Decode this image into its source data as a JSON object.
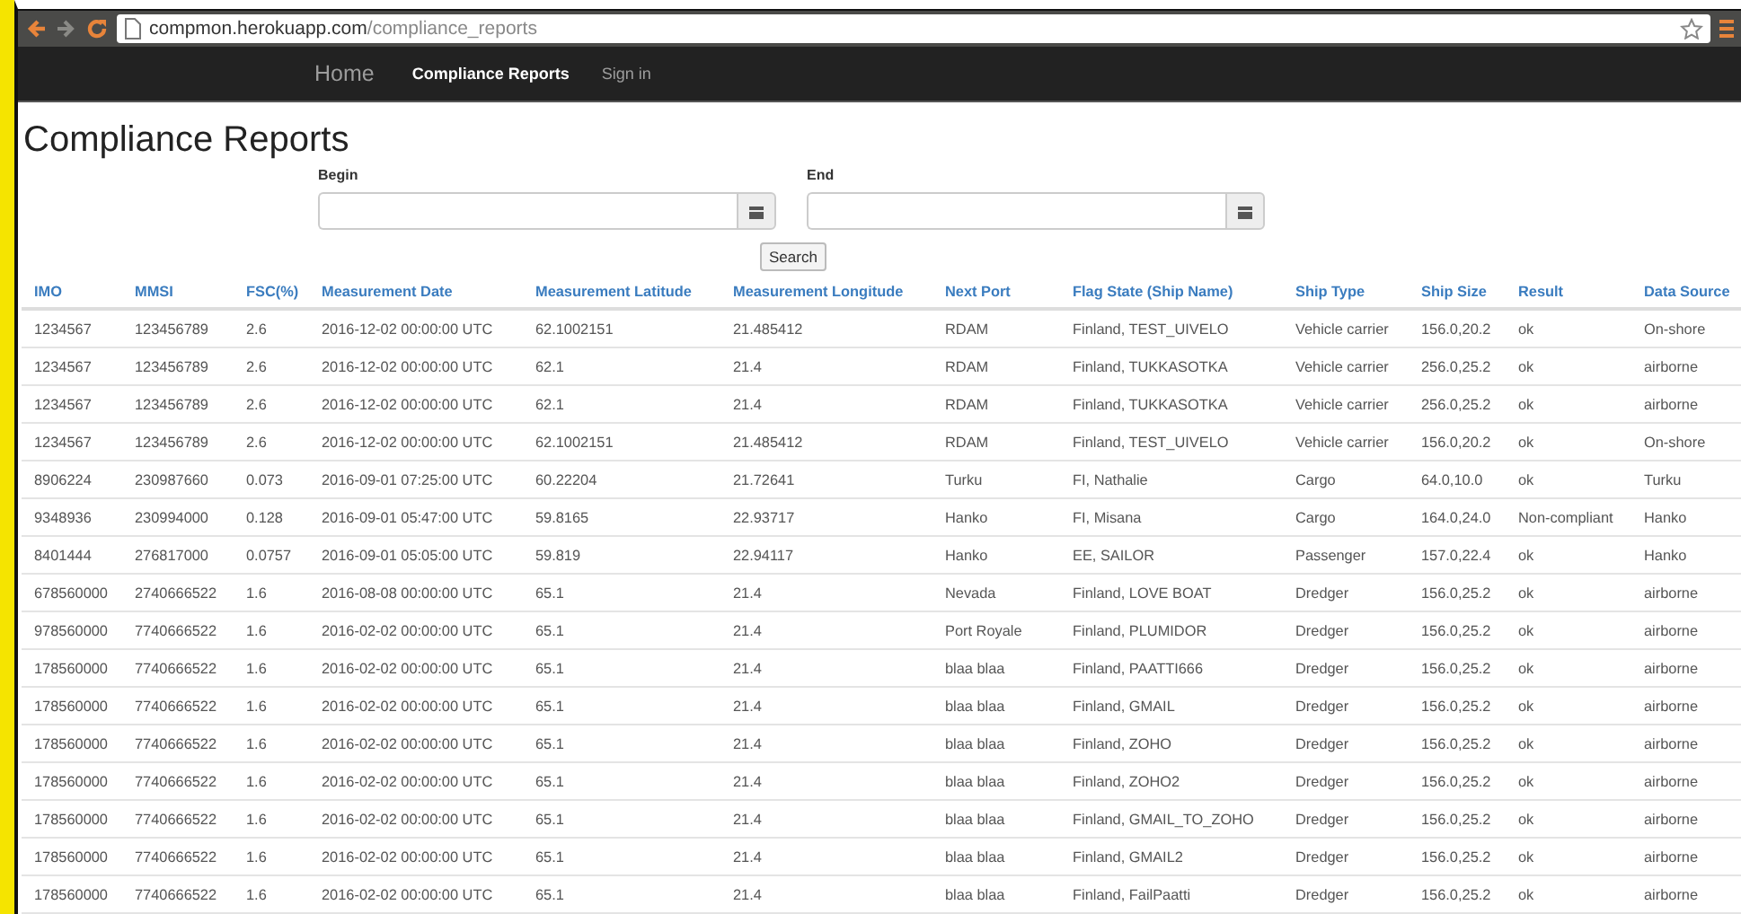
{
  "browser": {
    "url_host": "compmon.herokuapp.com",
    "url_path": "/compliance_reports",
    "back_disabled": false,
    "forward_disabled": true
  },
  "nav": {
    "brand": "Home",
    "items": [
      {
        "label": "Compliance Reports",
        "selected": true
      },
      {
        "label": "Sign in",
        "selected": false
      }
    ]
  },
  "title": "Compliance Reports",
  "filters": [
    {
      "label": "Begin"
    },
    {
      "label": "End"
    }
  ],
  "search_button": "Search",
  "table": {
    "columns": [
      "IMO",
      "MMSI",
      "FSC(%)",
      "Measurement Date",
      "Measurement Latitude",
      "Measurement Longitude",
      "Next Port",
      "Flag State (Ship Name)",
      "Ship Type",
      "Ship Size",
      "Result",
      "Data Source"
    ],
    "rows": [
      [
        "1234567",
        "123456789",
        "2.6",
        "2016-12-02 00:00:00 UTC",
        "62.1002151",
        "21.485412",
        "RDAM",
        "Finland, TEST_UIVELO",
        "Vehicle carrier",
        "156.0,20.2",
        "ok",
        "On-shore"
      ],
      [
        "1234567",
        "123456789",
        "2.6",
        "2016-12-02 00:00:00 UTC",
        "62.1",
        "21.4",
        "RDAM",
        "Finland, TUKKASOTKA",
        "Vehicle carrier",
        "256.0,25.2",
        "ok",
        "airborne"
      ],
      [
        "1234567",
        "123456789",
        "2.6",
        "2016-12-02 00:00:00 UTC",
        "62.1",
        "21.4",
        "RDAM",
        "Finland, TUKKASOTKA",
        "Vehicle carrier",
        "256.0,25.2",
        "ok",
        "airborne"
      ],
      [
        "1234567",
        "123456789",
        "2.6",
        "2016-12-02 00:00:00 UTC",
        "62.1002151",
        "21.485412",
        "RDAM",
        "Finland, TEST_UIVELO",
        "Vehicle carrier",
        "156.0,20.2",
        "ok",
        "On-shore"
      ],
      [
        "8906224",
        "230987660",
        "0.073",
        "2016-09-01 07:25:00 UTC",
        "60.22204",
        "21.72641",
        "Turku",
        "FI, Nathalie",
        "Cargo",
        "64.0,10.0",
        "ok",
        "Turku"
      ],
      [
        "9348936",
        "230994000",
        "0.128",
        "2016-09-01 05:47:00 UTC",
        "59.8165",
        "22.93717",
        "Hanko",
        "FI, Misana",
        "Cargo",
        "164.0,24.0",
        "Non-compliant",
        "Hanko"
      ],
      [
        "8401444",
        "276817000",
        "0.0757",
        "2016-09-01 05:05:00 UTC",
        "59.819",
        "22.94117",
        "Hanko",
        "EE, SAILOR",
        "Passenger",
        "157.0,22.4",
        "ok",
        "Hanko"
      ],
      [
        "678560000",
        "2740666522",
        "1.6",
        "2016-08-08 00:00:00 UTC",
        "65.1",
        "21.4",
        "Nevada",
        "Finland, LOVE BOAT",
        "Dredger",
        "156.0,25.2",
        "ok",
        "airborne"
      ],
      [
        "978560000",
        "7740666522",
        "1.6",
        "2016-02-02 00:00:00 UTC",
        "65.1",
        "21.4",
        "Port Royale",
        "Finland, PLUMIDOR",
        "Dredger",
        "156.0,25.2",
        "ok",
        "airborne"
      ],
      [
        "178560000",
        "7740666522",
        "1.6",
        "2016-02-02 00:00:00 UTC",
        "65.1",
        "21.4",
        "blaa blaa",
        "Finland, PAATTI666",
        "Dredger",
        "156.0,25.2",
        "ok",
        "airborne"
      ],
      [
        "178560000",
        "7740666522",
        "1.6",
        "2016-02-02 00:00:00 UTC",
        "65.1",
        "21.4",
        "blaa blaa",
        "Finland, GMAIL",
        "Dredger",
        "156.0,25.2",
        "ok",
        "airborne"
      ],
      [
        "178560000",
        "7740666522",
        "1.6",
        "2016-02-02 00:00:00 UTC",
        "65.1",
        "21.4",
        "blaa blaa",
        "Finland, ZOHO",
        "Dredger",
        "156.0,25.2",
        "ok",
        "airborne"
      ],
      [
        "178560000",
        "7740666522",
        "1.6",
        "2016-02-02 00:00:00 UTC",
        "65.1",
        "21.4",
        "blaa blaa",
        "Finland, ZOHO2",
        "Dredger",
        "156.0,25.2",
        "ok",
        "airborne"
      ],
      [
        "178560000",
        "7740666522",
        "1.6",
        "2016-02-02 00:00:00 UTC",
        "65.1",
        "21.4",
        "blaa blaa",
        "Finland, GMAIL_TO_ZOHO",
        "Dredger",
        "156.0,25.2",
        "ok",
        "airborne"
      ],
      [
        "178560000",
        "7740666522",
        "1.6",
        "2016-02-02 00:00:00 UTC",
        "65.1",
        "21.4",
        "blaa blaa",
        "Finland, GMAIL2",
        "Dredger",
        "156.0,25.2",
        "ok",
        "airborne"
      ],
      [
        "178560000",
        "7740666522",
        "1.6",
        "2016-02-02 00:00:00 UTC",
        "65.1",
        "21.4",
        "blaa blaa",
        "Finland, FailPaatti",
        "Dredger",
        "156.0,25.2",
        "ok",
        "airborne"
      ]
    ]
  }
}
